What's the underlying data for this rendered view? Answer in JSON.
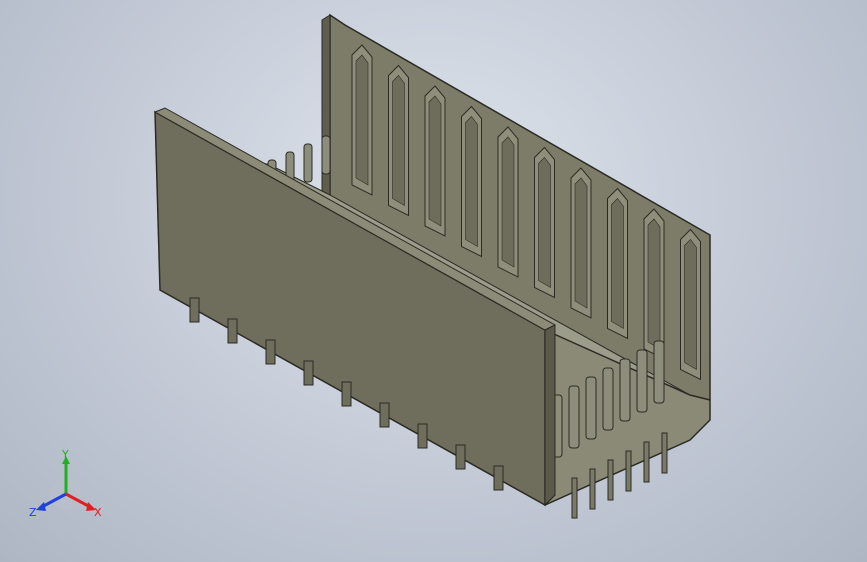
{
  "viewport": {
    "background_top": "#dfe4ec",
    "background_bottom": "#aeb6c4"
  },
  "model": {
    "part": "connector-housing",
    "body_color": "#6f6e5c",
    "edge_color": "#2b2b25",
    "inner_color": "#8a8a76",
    "floor_color": "#9c9c8a",
    "pin_color": "#8d8d7c"
  },
  "triad": {
    "x_label": "X",
    "y_label": "Y",
    "z_label": "Z",
    "x_color": "#e02020",
    "y_color": "#20b020",
    "z_color": "#2040e0"
  }
}
